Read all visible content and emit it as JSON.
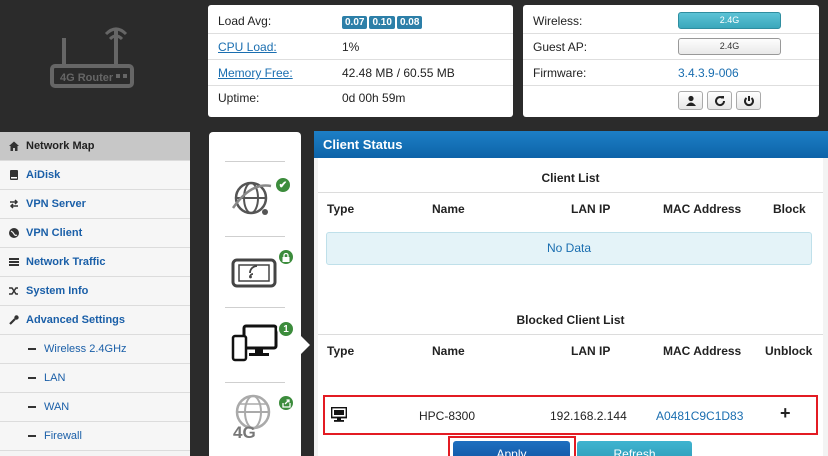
{
  "logo": {
    "label": "4G Router"
  },
  "stats": {
    "load_avg": {
      "label": "Load Avg:",
      "values": [
        "0.07",
        "0.10",
        "0.08"
      ]
    },
    "cpu_load": {
      "label": "CPU Load:",
      "value": "1%"
    },
    "memory_free": {
      "label": "Memory Free:",
      "value": "42.48 MB / 60.55 MB"
    },
    "uptime": {
      "label": "Uptime:",
      "value": "0d 00h 59m"
    }
  },
  "firmware_panel": {
    "wireless": {
      "label": "Wireless:",
      "value": "2.4G"
    },
    "guest_ap": {
      "label": "Guest AP:",
      "value": "2.4G"
    },
    "firmware": {
      "label": "Firmware:",
      "value": "3.4.3.9-006"
    }
  },
  "sidebar": {
    "items": [
      {
        "label": "Network Map",
        "icon": "home-icon",
        "active": true
      },
      {
        "label": "AiDisk",
        "icon": "disk-icon"
      },
      {
        "label": "VPN Server",
        "icon": "swap-icon"
      },
      {
        "label": "VPN Client",
        "icon": "globe-icon"
      },
      {
        "label": "Network Traffic",
        "icon": "list-icon"
      },
      {
        "label": "System Info",
        "icon": "shuffle-icon"
      },
      {
        "label": "Advanced Settings",
        "icon": "wrench-icon"
      },
      {
        "label": "Wireless 2.4GHz",
        "sub": true
      },
      {
        "label": "LAN",
        "sub": true
      },
      {
        "label": "WAN",
        "sub": true
      },
      {
        "label": "Firewall",
        "sub": true
      }
    ]
  },
  "middle": {
    "clients_badge": "1",
    "modem_label": "4G"
  },
  "client_status": {
    "title": "Client Status",
    "client_list": {
      "title": "Client List",
      "headers": [
        "Type",
        "Name",
        "LAN IP",
        "MAC Address",
        "Block"
      ],
      "empty": "No Data"
    },
    "blocked_list": {
      "title": "Blocked Client List",
      "headers": [
        "Type",
        "Name",
        "LAN IP",
        "MAC Address",
        "Unblock"
      ],
      "rows": [
        {
          "name": "HPC-8300",
          "ip": "192.168.2.144",
          "mac": "A0481C9C1D83",
          "action": "+"
        }
      ]
    },
    "apply_label": "Apply",
    "refresh_label": "Refresh"
  },
  "colors": {
    "header_blue": "#0d63a8",
    "link_blue": "#1a6eb0",
    "highlight_red": "#e31b23",
    "badge_green": "#3c8c3c"
  }
}
